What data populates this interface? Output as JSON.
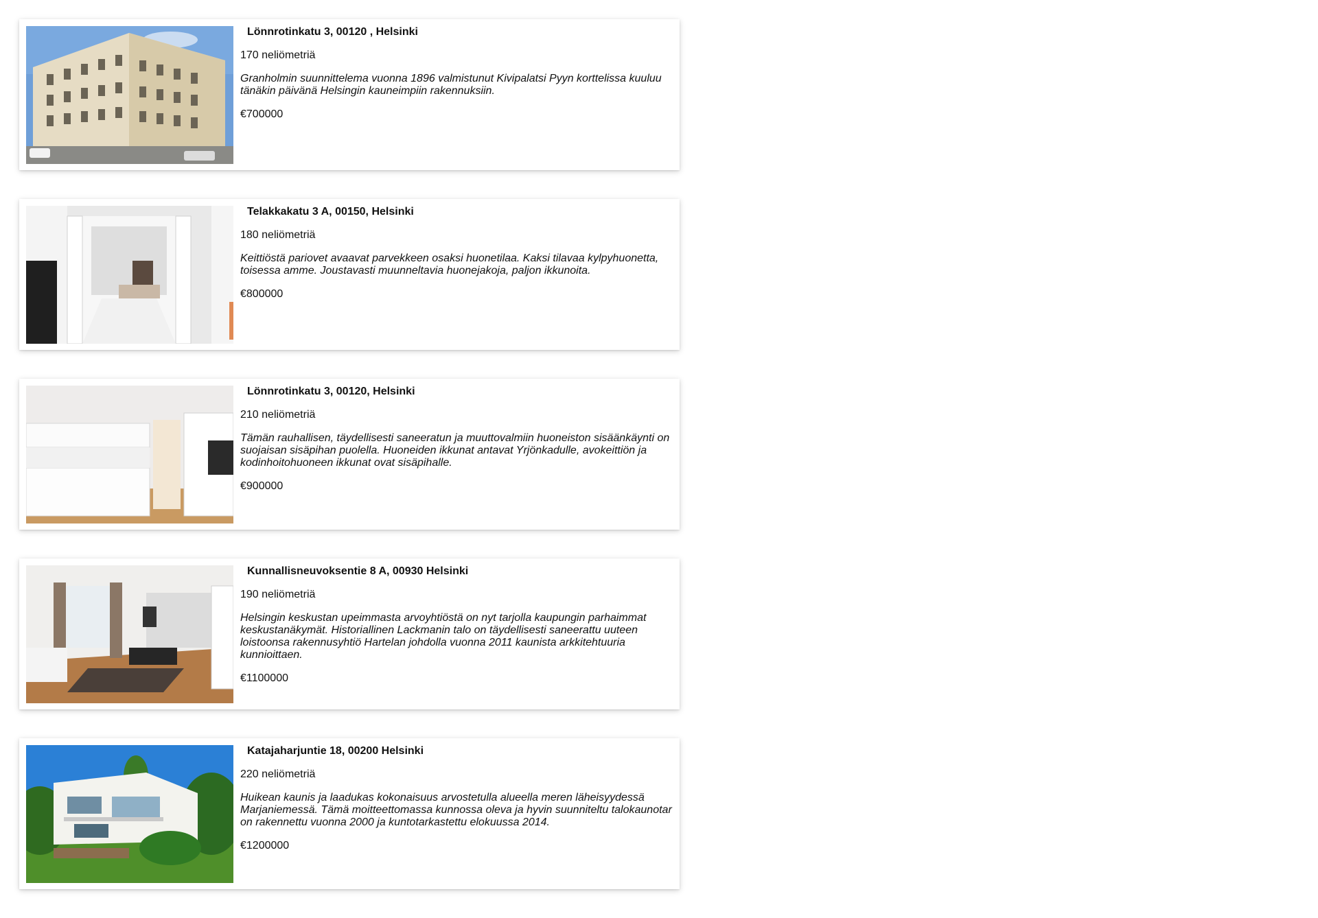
{
  "listings": [
    {
      "address": "Lönnrotinkatu 3, 00120 , Helsinki",
      "size": "170 neliömetriä",
      "description": "Granholmin suunnittelema vuonna 1896 valmistunut Kivipalatsi Pyyn korttelissa kuuluu tänäkin päivänä Helsingin kauneimpiin rakennuksiin.",
      "price": "€700000",
      "image_icon": "building-exterior-photo"
    },
    {
      "address": "Telakkakatu 3 A, 00150, Helsinki",
      "size": "180 neliömetriä",
      "description": "Keittiöstä pariovet avaavat parvekkeen osaksi huonetilaa. Kaksi tilavaa kylpyhuonetta, toisessa amme. Joustavasti muunneltavia huonejakoja, paljon ikkunoita.",
      "price": "€800000",
      "image_icon": "bedroom-interior-photo"
    },
    {
      "address": "Lönnrotinkatu 3, 00120, Helsinki",
      "size": "210 neliömetriä",
      "description": "Tämän rauhallisen, täydellisesti saneeratun ja muuttovalmiin huoneiston sisäänkäynti on suojaisan sisäpihan puolella. Huoneiden ikkunat antavat Yrjönkadulle, avokeittiön ja kodinhoitohuoneen ikkunat ovat sisäpihalle.",
      "price": "€900000",
      "image_icon": "kitchen-interior-photo"
    },
    {
      "address": "Kunnallisneuvoksentie 8 A, 00930 Helsinki",
      "size": "190 neliömetriä",
      "description": "Helsingin keskustan upeimmasta arvoyhtiöstä on nyt tarjolla kaupungin parhaimmat keskustanäkymät. Historiallinen Lackmanin talo on täydellisesti saneerattu uuteen loistoonsa rakennusyhtiö Hartelan johdolla vuonna 2011 kaunista arkkitehtuuria kunnioittaen.",
      "price": "€1100000",
      "image_icon": "living-room-interior-photo"
    },
    {
      "address": "Katajaharjuntie 18, 00200 Helsinki",
      "size": "220 neliömetriä",
      "description": "Huikean kaunis ja laadukas kokonaisuus arvostetulla alueella meren läheisyydessä Marjaniemessä. Tämä moitteettomassa kunnossa oleva ja hyvin suunniteltu talokaunotar on rakennettu vuonna 2000 ja kuntotarkastettu elokuussa 2014.",
      "price": "€1200000",
      "image_icon": "house-exterior-photo"
    }
  ]
}
